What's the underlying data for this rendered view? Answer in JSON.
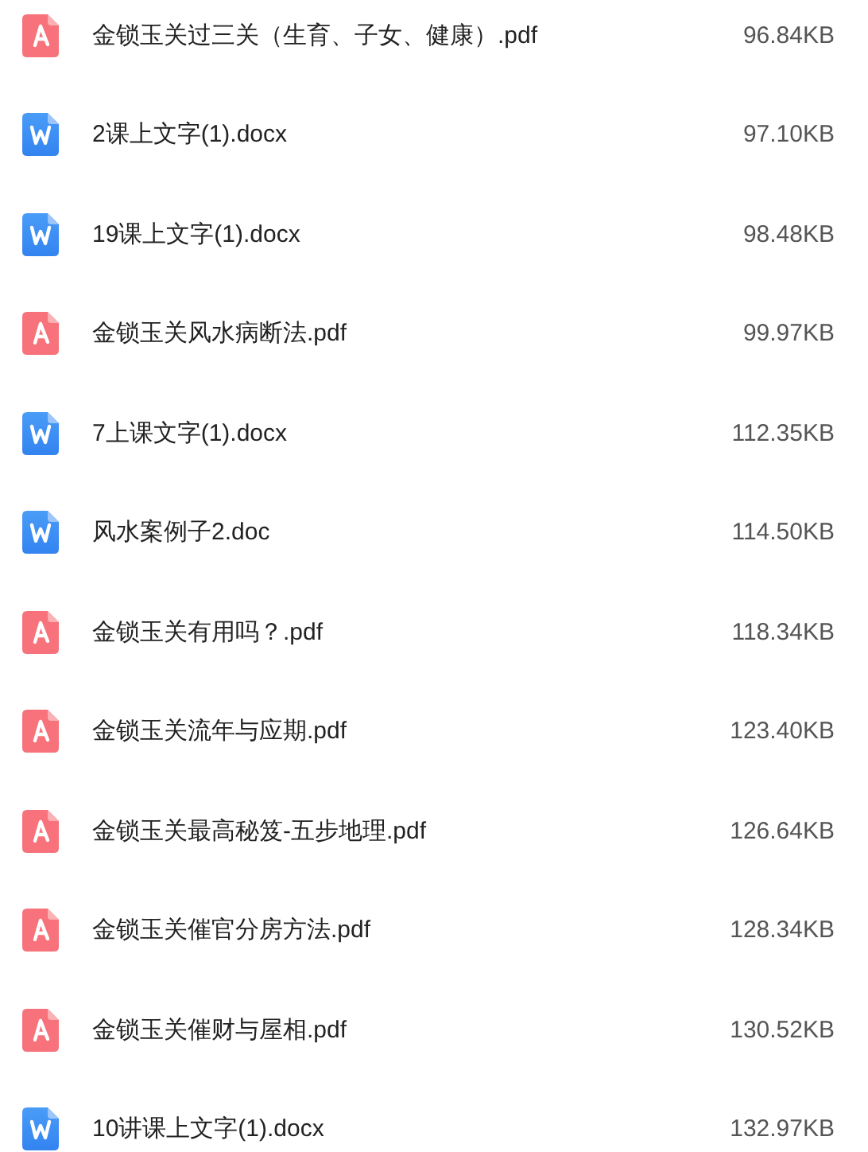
{
  "files": [
    {
      "kind": "pdf",
      "name": "金锁玉关过三关（生育、子女、健康）.pdf",
      "size": "96.84KB"
    },
    {
      "kind": "doc",
      "name": "2课上文字(1).docx",
      "size": "97.10KB"
    },
    {
      "kind": "doc",
      "name": "19课上文字(1).docx",
      "size": "98.48KB"
    },
    {
      "kind": "pdf",
      "name": "金锁玉关风水病断法.pdf",
      "size": "99.97KB"
    },
    {
      "kind": "doc",
      "name": "7上课文字(1).docx",
      "size": "112.35KB"
    },
    {
      "kind": "doc",
      "name": "风水案例子2.doc",
      "size": "114.50KB"
    },
    {
      "kind": "pdf",
      "name": "金锁玉关有用吗？.pdf",
      "size": "118.34KB"
    },
    {
      "kind": "pdf",
      "name": "金锁玉关流年与应期.pdf",
      "size": "123.40KB"
    },
    {
      "kind": "pdf",
      "name": "金锁玉关最高秘笈-五步地理.pdf",
      "size": "126.64KB"
    },
    {
      "kind": "pdf",
      "name": "金锁玉关催官分房方法.pdf",
      "size": "128.34KB"
    },
    {
      "kind": "pdf",
      "name": "金锁玉关催财与屋相.pdf",
      "size": "130.52KB"
    },
    {
      "kind": "doc",
      "name": "10讲课上文字(1).docx",
      "size": "132.97KB"
    }
  ]
}
